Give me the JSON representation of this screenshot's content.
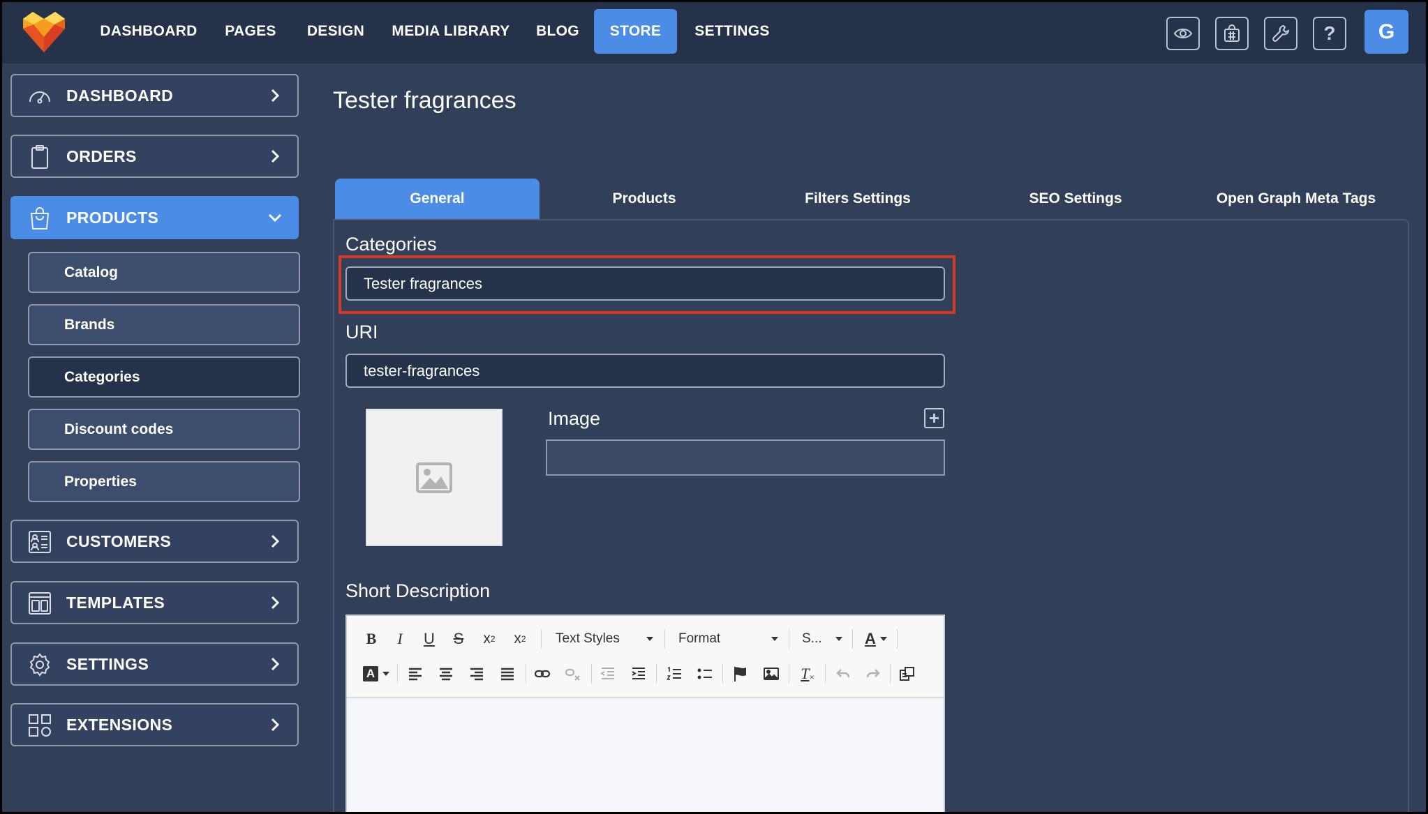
{
  "app": {
    "brand_colors": {
      "topbar": "#26324a",
      "background": "#323f58",
      "accent": "#4a8ce6",
      "highlight": "#d43a26"
    },
    "avatar_letter": "G"
  },
  "topnav": {
    "items": [
      {
        "label": "DASHBOARD",
        "active": false
      },
      {
        "label": "PAGES",
        "active": false
      },
      {
        "label": "DESIGN",
        "active": false
      },
      {
        "label": "MEDIA LIBRARY",
        "active": false
      },
      {
        "label": "BLOG",
        "active": false
      },
      {
        "label": "STORE",
        "active": true
      },
      {
        "label": "SETTINGS",
        "active": false
      }
    ],
    "tools": [
      "eye-icon",
      "shop-bag-icon",
      "wrench-icon",
      "help-icon"
    ],
    "help_label": "?"
  },
  "sidebar": {
    "items": [
      {
        "label": "DASHBOARD",
        "icon": "gauge-icon",
        "expanded": false
      },
      {
        "label": "ORDERS",
        "icon": "clipboard-icon",
        "expanded": false
      },
      {
        "label": "PRODUCTS",
        "icon": "shopping-bag-icon",
        "expanded": true
      },
      {
        "label": "CUSTOMERS",
        "icon": "contacts-icon",
        "expanded": false
      },
      {
        "label": "TEMPLATES",
        "icon": "template-icon",
        "expanded": false
      },
      {
        "label": "SETTINGS",
        "icon": "gear-icon",
        "expanded": false
      },
      {
        "label": "EXTENSIONS",
        "icon": "extensions-icon",
        "expanded": false
      }
    ],
    "subitems": [
      {
        "label": "Catalog",
        "current": false
      },
      {
        "label": "Brands",
        "current": false
      },
      {
        "label": "Categories",
        "current": true
      },
      {
        "label": "Discount codes",
        "current": false
      },
      {
        "label": "Properties",
        "current": false
      }
    ]
  },
  "main": {
    "title": "Tester fragrances",
    "tabs": [
      {
        "label": "General",
        "active": true
      },
      {
        "label": "Products",
        "active": false
      },
      {
        "label": "Filters Settings",
        "active": false
      },
      {
        "label": "SEO Settings",
        "active": false
      },
      {
        "label": "Open Graph Meta Tags",
        "active": false
      }
    ],
    "form": {
      "categories_label": "Categories",
      "categories_value": "Tester fragrances",
      "uri_label": "URI",
      "uri_value": "tester-fragrances",
      "image_label": "Image",
      "image_value": "",
      "short_description_label": "Short Description"
    },
    "editor": {
      "text_styles": "Text Styles",
      "format": "Format",
      "size": "S...",
      "bold": "B",
      "italic": "I",
      "underline": "U",
      "strike": "S",
      "subscript": "x",
      "superscript": "x",
      "sub_mark": "2",
      "sup_mark": "2",
      "font_color": "A",
      "bg_color": "A",
      "remove_format": "T"
    }
  }
}
